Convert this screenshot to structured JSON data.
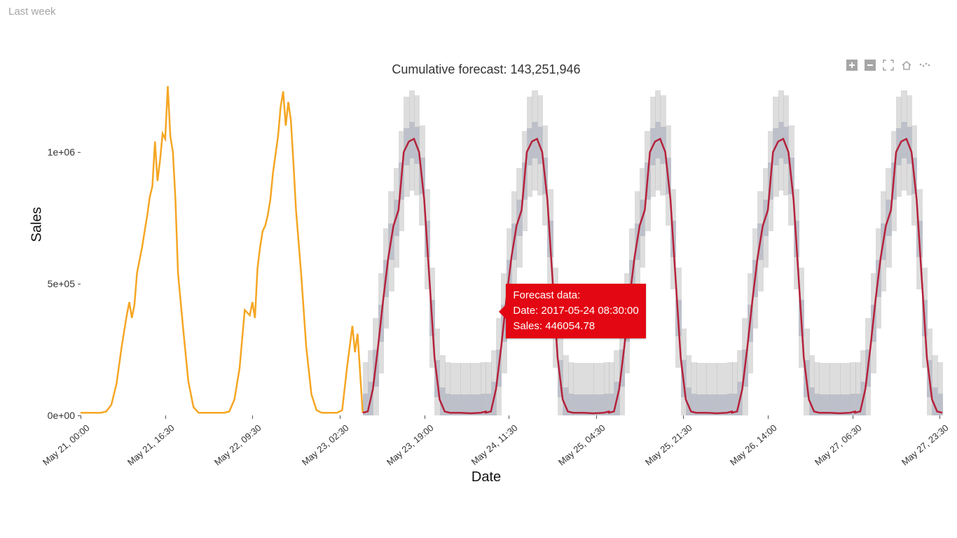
{
  "top_label": "Last week",
  "title": "Cumulative forecast: 143,251,946",
  "xlabel": "Date",
  "ylabel": "Sales",
  "yticks": [
    {
      "label": "0e+00",
      "value": 0
    },
    {
      "label": "5e+05",
      "value": 500000
    },
    {
      "label": "1e+06",
      "value": 1000000
    }
  ],
  "xticks": [
    {
      "label": "May 21, 00:00",
      "t": 0.0
    },
    {
      "label": "May 21, 16:30",
      "t": 16.5
    },
    {
      "label": "May 22, 09:30",
      "t": 33.5
    },
    {
      "label": "May 23, 02:30",
      "t": 50.5
    },
    {
      "label": "May 23, 19:00",
      "t": 67.0
    },
    {
      "label": "May 24, 11:30",
      "t": 83.5
    },
    {
      "label": "May 25, 04:30",
      "t": 100.5
    },
    {
      "label": "May 25, 21:30",
      "t": 117.5
    },
    {
      "label": "May 26, 14:00",
      "t": 134.0
    },
    {
      "label": "May 27, 06:30",
      "t": 150.5
    },
    {
      "label": "May 27, 23:30",
      "t": 167.5
    }
  ],
  "tooltip": {
    "header": "Forecast data:",
    "line_date": "Date: 2017-05-24 08:30:00",
    "line_sales": "Sales: 446054.78"
  },
  "toolbar": {
    "zoom_in": "plus-icon",
    "zoom_out": "minus-icon",
    "fullscreen": "expand-icon",
    "home": "home-icon",
    "more": "more-icon"
  },
  "chart_data": {
    "type": "line",
    "xlabel": "Date",
    "ylabel": "Sales",
    "ylim": [
      0,
      1250000
    ],
    "x_range_hours": [
      0,
      168
    ],
    "title": "Cumulative forecast: 143,251,946",
    "series": [
      {
        "name": "historical",
        "color": "#f5a623",
        "x": [
          0,
          2,
          4,
          5,
          6,
          7,
          8,
          9,
          9.5,
          10,
          10.5,
          11,
          11.5,
          12,
          12.5,
          13,
          13.5,
          14,
          14.5,
          15,
          15.5,
          16,
          16.5,
          17,
          17.5,
          18,
          18.5,
          19,
          20,
          21,
          22,
          23,
          24,
          26,
          28,
          29,
          30,
          31,
          32,
          33,
          33.5,
          34,
          34.5,
          35,
          35.5,
          36,
          36.5,
          37,
          37.5,
          38,
          38.5,
          39,
          39.5,
          40,
          40.5,
          41,
          41.5,
          42,
          43,
          44,
          45,
          46,
          47,
          48,
          49,
          50,
          51,
          52,
          53,
          53.5,
          54,
          55
        ],
        "y": [
          10000,
          10000,
          10000,
          15000,
          40000,
          120000,
          260000,
          380000,
          430000,
          370000,
          420000,
          540000,
          590000,
          640000,
          700000,
          760000,
          830000,
          870000,
          1040000,
          890000,
          970000,
          1070000,
          1050000,
          1250000,
          1060000,
          1000000,
          820000,
          540000,
          330000,
          130000,
          32000,
          10000,
          10000,
          10000,
          10000,
          15000,
          60000,
          180000,
          400000,
          380000,
          430000,
          370000,
          560000,
          640000,
          700000,
          720000,
          760000,
          820000,
          920000,
          990000,
          1060000,
          1170000,
          1230000,
          1100000,
          1190000,
          1120000,
          960000,
          780000,
          540000,
          260000,
          80000,
          20000,
          10000,
          10000,
          10000,
          10000,
          20000,
          190000,
          340000,
          240000,
          310000,
          10000
        ]
      },
      {
        "name": "forecast_mean",
        "color": "#b5213a",
        "x": [
          55,
          56,
          57,
          58,
          59,
          60,
          61,
          62,
          63,
          64,
          65,
          66,
          67,
          68,
          69,
          70,
          71,
          72,
          74,
          76,
          78,
          79
        ],
        "y": [
          10000,
          15000,
          100000,
          260000,
          440000,
          600000,
          720000,
          780000,
          1000000,
          1040000,
          1050000,
          1000000,
          820000,
          520000,
          220000,
          60000,
          15000,
          10000,
          10000,
          8000,
          10000,
          15000
        ],
        "repeats_every_hours": 24,
        "repeat_count": 5
      },
      {
        "name": "forecast_inner_band",
        "lower_offset": -70000,
        "upper_offset": 70000,
        "of_series": "forecast_mean"
      },
      {
        "name": "forecast_outer_band",
        "lower_offset": -190000,
        "upper_offset": 190000,
        "of_series": "forecast_mean"
      }
    ],
    "tooltip_point": {
      "series": "forecast_mean",
      "date": "2017-05-24 08:30:00",
      "x": 80.5,
      "y": 446054.78
    }
  }
}
